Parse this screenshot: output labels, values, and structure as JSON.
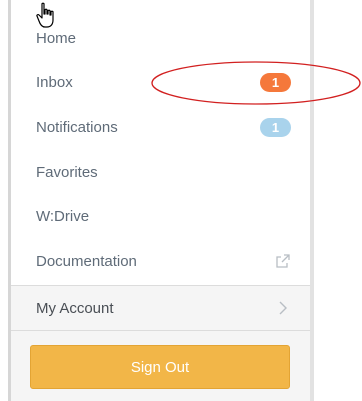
{
  "menu": {
    "items": [
      {
        "label": "Home"
      },
      {
        "label": "Inbox",
        "badge": "1"
      },
      {
        "label": "Notifications",
        "badge": "1"
      },
      {
        "label": "Favorites"
      },
      {
        "label": "W:Drive"
      },
      {
        "label": "Documentation",
        "icon": "external-link-icon"
      }
    ],
    "account": {
      "label": "My Account",
      "icon": "chevron-right-icon"
    },
    "sign_out_label": "Sign Out"
  },
  "colors": {
    "inbox_badge": "#f5783b",
    "notifications_badge": "#a9d3ec",
    "sign_out_button": "#f2b648",
    "annotation_ellipse": "#d22020"
  },
  "icons": [
    "hand-pointer-cursor-icon",
    "external-link-icon",
    "chevron-right-icon"
  ]
}
